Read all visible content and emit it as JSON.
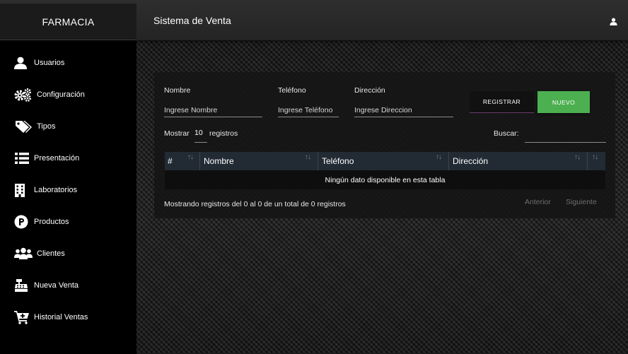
{
  "header": {
    "brand": "FARMACIA",
    "title": "Sistema de Venta",
    "user_icon": "user-icon"
  },
  "sidebar": {
    "items": [
      {
        "label": "Usuarios",
        "icon": "user-icon"
      },
      {
        "label": "Configuración",
        "icon": "cogs-icon"
      },
      {
        "label": "Tipos",
        "icon": "tags-icon"
      },
      {
        "label": "Presentación",
        "icon": "list-icon"
      },
      {
        "label": "Laboratorios",
        "icon": "building-icon"
      },
      {
        "label": "Productos",
        "icon": "product-p-icon"
      },
      {
        "label": "Clientes",
        "icon": "users-icon"
      },
      {
        "label": "Nueva Venta",
        "icon": "cash-register-icon"
      },
      {
        "label": "Historial Ventas",
        "icon": "cart-plus-icon"
      }
    ]
  },
  "form": {
    "nombre_label": "Nombre",
    "nombre_placeholder": "Ingrese Nombre",
    "telefono_label": "Teléfono",
    "telefono_placeholder": "Ingrese Teléfono",
    "direccion_label": "Dirección",
    "direccion_placeholder": "Ingrese Direccion",
    "registrar_label": "REGISTRAR",
    "nuevo_label": "NUEVO"
  },
  "table": {
    "show_prefix": "Mostrar",
    "page_length": "10",
    "show_suffix": "registros",
    "search_label": "Buscar:",
    "columns": [
      "#",
      "Nombre",
      "Teléfono",
      "Dirección"
    ],
    "empty_text": "Ningún dato disponible en esta tabla",
    "info": "Mostrando registros del 0 al 0 de un total de 0 registros",
    "prev": "Anterior",
    "next": "Siguiente"
  },
  "colors": {
    "accent_green": "#4caf50",
    "sidebar_bg": "#000000",
    "table_head_bg": "#222a33"
  }
}
